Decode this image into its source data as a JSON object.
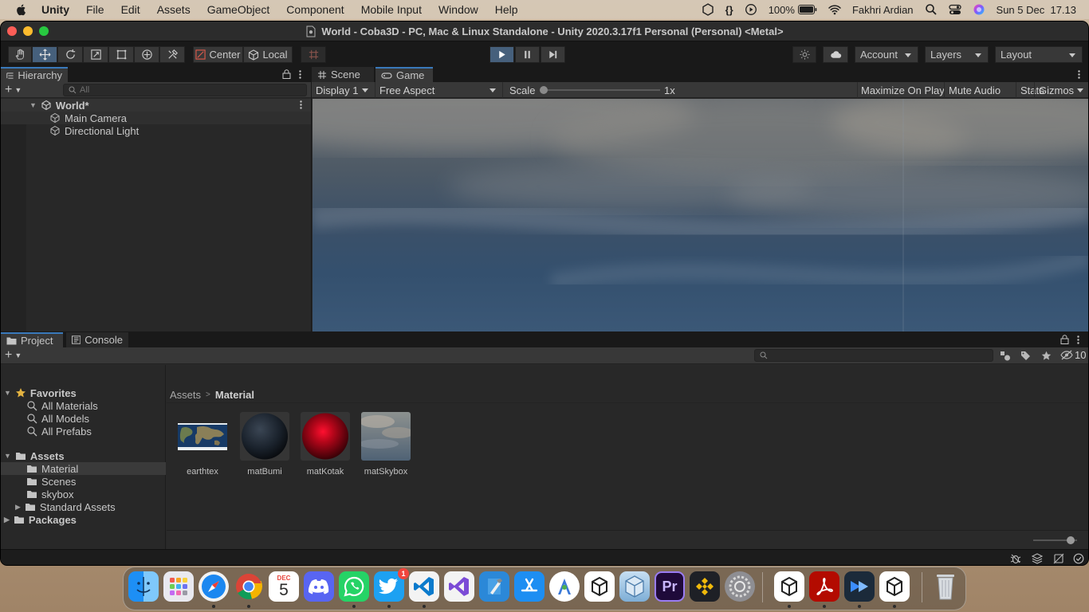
{
  "menubar": {
    "app_name": "Unity",
    "items": [
      "File",
      "Edit",
      "Assets",
      "GameObject",
      "Component",
      "Mobile Input",
      "Window",
      "Help"
    ],
    "braces": "{}",
    "battery": "100%",
    "user": "Fakhri Ardian",
    "clock": "Sun 5 Dec  17.13"
  },
  "window": {
    "title": "World - Coba3D - PC, Mac & Linux Standalone - Unity 2020.3.17f1 Personal (Personal) <Metal>"
  },
  "toolbar": {
    "pivot_label": "Center",
    "space_label": "Local",
    "account_label": "Account",
    "layers_label": "Layers",
    "layout_label": "Layout"
  },
  "hierarchy": {
    "tab_label": "Hierarchy",
    "search_placeholder": "All",
    "scene_name": "World*",
    "objects": [
      "Main Camera",
      "Directional Light"
    ]
  },
  "game_view": {
    "tabs": [
      "Scene",
      "Game"
    ],
    "display": "Display 1",
    "aspect": "Free Aspect",
    "scale_label": "Scale",
    "scale_value": "1x",
    "scale_level": 0.0,
    "buttons": [
      "Maximize On Play",
      "Mute Audio",
      "Stats",
      "Gizmos"
    ]
  },
  "project": {
    "tabs": [
      "Project",
      "Console"
    ],
    "hidden_count": "10",
    "favorites_label": "Favorites",
    "favorites": [
      "All Materials",
      "All Models",
      "All Prefabs"
    ],
    "assets_label": "Assets",
    "asset_folders": [
      "Material",
      "Scenes",
      "skybox",
      "Standard Assets"
    ],
    "packages_label": "Packages",
    "breadcrumb": [
      "Assets",
      "Material"
    ],
    "items": [
      "earthtex",
      "matBumi",
      "matKotak",
      "matSkybox"
    ],
    "zoom_level": 0.85
  },
  "dock": {
    "calendar_month": "DEC",
    "calendar_day": "5",
    "twitter_badge": "1",
    "premiere_label": "Pr",
    "apps": [
      "Finder",
      "Launchpad",
      "Safari",
      "Chrome",
      "Calendar",
      "Discord",
      "WhatsApp",
      "Twitter",
      "VS Code",
      "Visual Studio",
      "Xcode",
      "App Store",
      "Android Studio",
      "Unity Hub",
      "Unity",
      "Premiere Pro",
      "Binance",
      "System Preferences",
      "Unity Editor",
      "Acrobat",
      "Media Player",
      "Unity Player",
      "Trash"
    ]
  },
  "colors": {
    "accent": "#3a79bb",
    "panel": "#282828",
    "toolbar": "#191919",
    "play_active": "#46607c"
  }
}
